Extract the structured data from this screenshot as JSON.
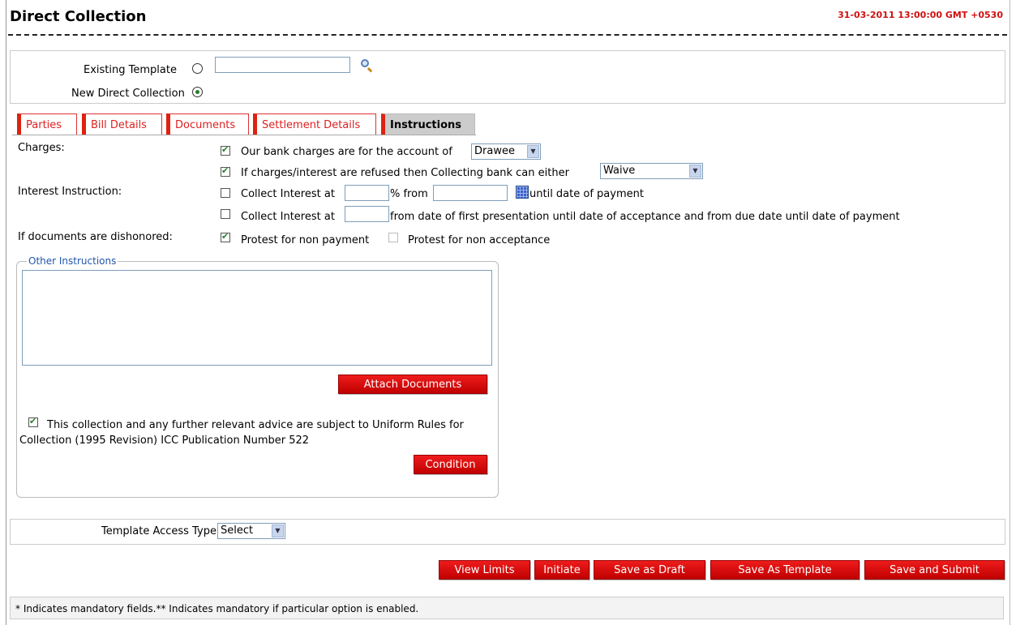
{
  "page": {
    "title": "Direct Collection",
    "datetime": "31-03-2011 13:00:00 GMT +0530"
  },
  "template_selection": {
    "existing_template_label": "Existing Template",
    "existing_template_selected": false,
    "existing_template_value": "",
    "new_direct_collection_label": "New Direct Collection",
    "new_direct_collection_selected": true
  },
  "tabs": [
    {
      "label": "Parties",
      "active": false
    },
    {
      "label": "Bill Details",
      "active": false
    },
    {
      "label": "Documents",
      "active": false
    },
    {
      "label": "Settlement Details",
      "active": false
    },
    {
      "label": "Instructions",
      "active": true
    }
  ],
  "instructions": {
    "charges_label": "Charges:",
    "bank_charges": {
      "checked": true,
      "text": "Our bank charges are for the account of",
      "select_value": "Drawee"
    },
    "refused_charges": {
      "checked": true,
      "text": "If charges/interest are refused then Collecting bank can either",
      "select_value": "Waive"
    },
    "interest_label": "Interest Instruction:",
    "interest_1": {
      "checked": false,
      "text_a": "Collect Interest at",
      "text_b": "% from",
      "text_c": "until date of payment",
      "rate": "",
      "from_date": ""
    },
    "interest_2": {
      "checked": false,
      "text_a": "Collect Interest at",
      "text_b": "from date of first presentation until date of acceptance and from due date until date of payment",
      "rate": ""
    },
    "dishonored_label": "If documents are dishonored:",
    "protest_non_payment": {
      "checked": true,
      "text": "Protest for non payment"
    },
    "protest_non_acceptance": {
      "checked": false,
      "text": "Protest for non acceptance"
    }
  },
  "other_instructions": {
    "legend": "Other Instructions",
    "text": "",
    "attach_button": "Attach Documents",
    "urc_checked": true,
    "urc_text": "This collection and any further relevant advice are subject to Uniform Rules for Collection (1995 Revision) ICC Publication Number 522",
    "condition_button": "Condition"
  },
  "template_access": {
    "label": "Template Access Type:",
    "value": "Select"
  },
  "actions": {
    "view_limits": "View Limits",
    "initiate": "Initiate",
    "save_draft": "Save as Draft",
    "save_template": "Save As Template",
    "save_submit": "Save and Submit"
  },
  "footer": {
    "note": "* Indicates mandatory fields.** Indicates mandatory if particular option is enabled."
  },
  "colors": {
    "accent_red": "#d21010",
    "check_green": "#2a7d2a",
    "link_blue": "#2255aa"
  }
}
